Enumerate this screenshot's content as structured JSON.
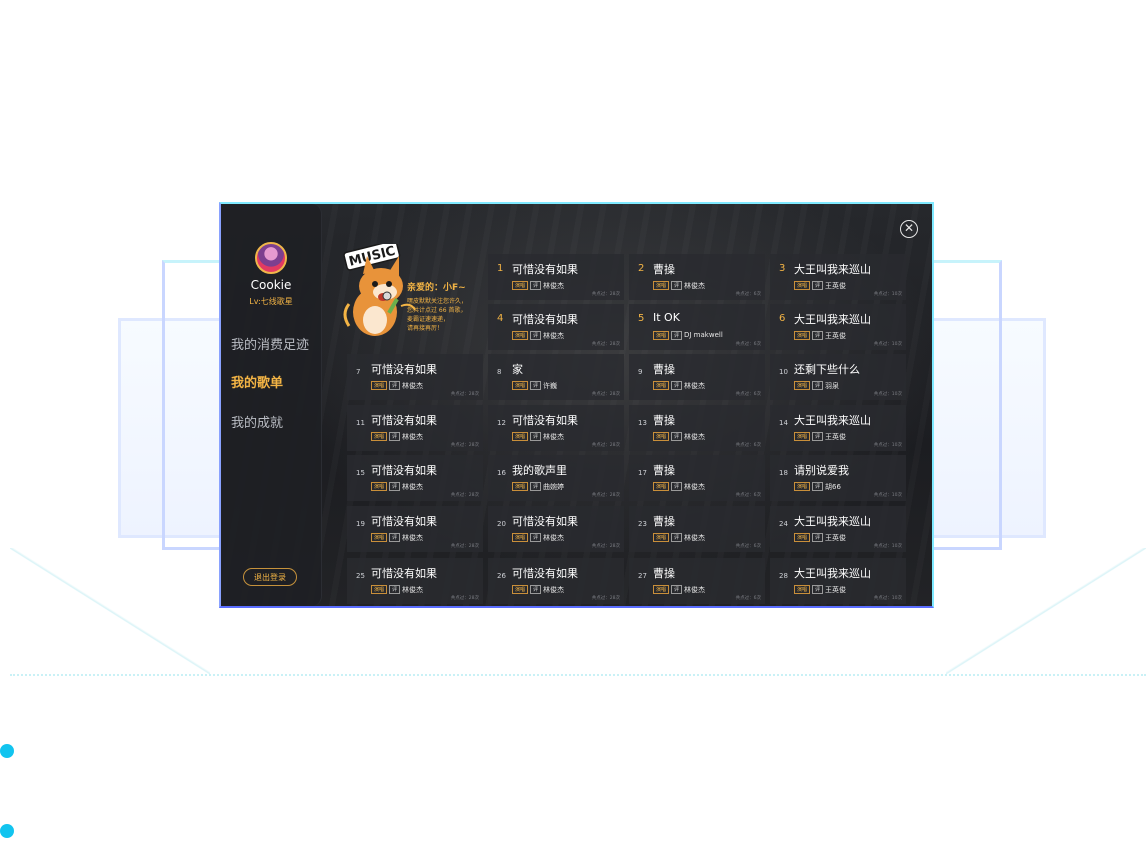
{
  "user": {
    "name": "Cookie",
    "level": "Lv:七线歌星"
  },
  "nav": [
    {
      "label": "我的消费足迹",
      "active": false
    },
    {
      "label": "我的歌单",
      "active": true
    },
    {
      "label": "我的成就",
      "active": false
    }
  ],
  "logout_label": "退出登录",
  "greeting": {
    "badge": "MUSIC",
    "title": "亲爱的：小F~",
    "lines": [
      "嘿皮默默关注您许久，",
      "您共计点过 66 首歌，",
      "麦霸证速速递，",
      "请再接再厉！"
    ]
  },
  "tags": {
    "sing": "演唱",
    "comment": "评"
  },
  "songs": [
    {
      "num": "1",
      "title": "可惜没有如果",
      "artist": "林俊杰",
      "plays": "共点过：28次"
    },
    {
      "num": "2",
      "title": "曹操",
      "artist": "林俊杰",
      "plays": "共点过：6次"
    },
    {
      "num": "3",
      "title": "大王叫我来巡山",
      "artist": "王英俊",
      "plays": "共点过：10次"
    },
    {
      "num": "4",
      "title": "可惜没有如果",
      "artist": "林俊杰",
      "plays": "共点过：28次"
    },
    {
      "num": "5",
      "title": "It OK",
      "artist": "DJ makwell",
      "plays": "共点过：6次"
    },
    {
      "num": "6",
      "title": "大王叫我来巡山",
      "artist": "王英俊",
      "plays": "共点过：10次"
    },
    {
      "num": "7",
      "title": "可惜没有如果",
      "artist": "林俊杰",
      "plays": "共点过：28次"
    },
    {
      "num": "8",
      "title": "家",
      "artist": "许巍",
      "plays": "共点过：28次"
    },
    {
      "num": "9",
      "title": "曹操",
      "artist": "林俊杰",
      "plays": "共点过：6次"
    },
    {
      "num": "10",
      "title": "还剩下些什么",
      "artist": "羽泉",
      "plays": "共点过：10次"
    },
    {
      "num": "11",
      "title": "可惜没有如果",
      "artist": "林俊杰",
      "plays": "共点过：28次"
    },
    {
      "num": "12",
      "title": "可惜没有如果",
      "artist": "林俊杰",
      "plays": "共点过：28次"
    },
    {
      "num": "13",
      "title": "曹操",
      "artist": "林俊杰",
      "plays": "共点过：6次"
    },
    {
      "num": "14",
      "title": "大王叫我来巡山",
      "artist": "王英俊",
      "plays": "共点过：10次"
    },
    {
      "num": "15",
      "title": "可惜没有如果",
      "artist": "林俊杰",
      "plays": "共点过：28次"
    },
    {
      "num": "16",
      "title": "我的歌声里",
      "artist": "曲婉婷",
      "plays": "共点过：28次"
    },
    {
      "num": "17",
      "title": "曹操",
      "artist": "林俊杰",
      "plays": "共点过：6次"
    },
    {
      "num": "18",
      "title": "请别说爱我",
      "artist": "胡66",
      "plays": "共点过：10次"
    },
    {
      "num": "19",
      "title": "可惜没有如果",
      "artist": "林俊杰",
      "plays": "共点过：28次"
    },
    {
      "num": "20",
      "title": "可惜没有如果",
      "artist": "林俊杰",
      "plays": "共点过：28次"
    },
    {
      "num": "23",
      "title": "曹操",
      "artist": "林俊杰",
      "plays": "共点过：6次"
    },
    {
      "num": "24",
      "title": "大王叫我来巡山",
      "artist": "王英俊",
      "plays": "共点过：10次"
    },
    {
      "num": "25",
      "title": "可惜没有如果",
      "artist": "林俊杰",
      "plays": "共点过：28次"
    },
    {
      "num": "26",
      "title": "可惜没有如果",
      "artist": "林俊杰",
      "plays": "共点过：28次"
    },
    {
      "num": "27",
      "title": "曹操",
      "artist": "林俊杰",
      "plays": "共点过：6次"
    },
    {
      "num": "28",
      "title": "大王叫我来巡山",
      "artist": "王英俊",
      "plays": "共点过：10次"
    }
  ],
  "colors": {
    "accent": "#f3b445",
    "frame": "#7fe9ff",
    "bullet": "#12c4ef"
  }
}
